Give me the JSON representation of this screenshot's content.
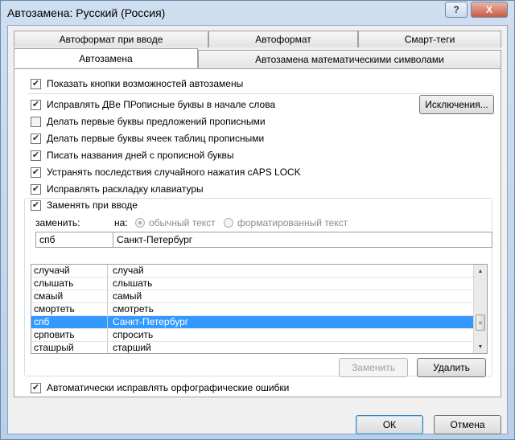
{
  "window": {
    "title": "Автозамена: Русский (Россия)",
    "help_label": "?",
    "close_label": "X"
  },
  "tabs": [
    {
      "label": "Автоформат при вводе"
    },
    {
      "label": "Автоформат"
    },
    {
      "label": "Смарт-теги"
    },
    {
      "label": "Автозамена"
    },
    {
      "label": "Автозамена математическими символами"
    }
  ],
  "options": {
    "show_buttons": {
      "label": "Показать кнопки возможностей автозамены",
      "checked": true
    },
    "two_caps": {
      "label": "Исправлять ДВе ПРописные буквы в начале слова",
      "checked": true
    },
    "sentence_caps": {
      "label": "Делать первые буквы предложений прописными",
      "checked": false
    },
    "table_caps": {
      "label": "Делать первые буквы ячеек таблиц прописными",
      "checked": true
    },
    "day_names": {
      "label": "Писать названия дней с прописной буквы",
      "checked": true
    },
    "caps_lock": {
      "label": "Устранять последствия случайного нажатия cAPS LOCK",
      "checked": true
    },
    "keyboard_layout": {
      "label": "Исправлять раскладку клавиатуры",
      "checked": true
    },
    "replace_typing": {
      "label": "Заменять при вводе",
      "checked": true
    },
    "auto_spelling": {
      "label": "Автоматически исправлять орфографические ошибки",
      "checked": true
    }
  },
  "exceptions_button": "Исключения...",
  "replace": {
    "replace_label": "заменить:",
    "with_label": "на:",
    "radio_plain": "обычный текст",
    "radio_formatted": "форматированный текст",
    "replace_value": "спб",
    "with_value": "Санкт-Петербург"
  },
  "list": {
    "rows": [
      {
        "from": "случачй",
        "to": "случай"
      },
      {
        "from": "слышать",
        "to": "слышать"
      },
      {
        "from": "смаый",
        "to": "самый"
      },
      {
        "from": "смортеть",
        "to": "смотреть"
      },
      {
        "from": "спб",
        "to": "Санкт-Петербург",
        "selected": true
      },
      {
        "from": "срповить",
        "to": "спросить"
      },
      {
        "from": "сташрый",
        "to": "старший"
      }
    ]
  },
  "buttons": {
    "replace": "Заменить",
    "delete": "Удалить",
    "ok": "ОК",
    "cancel": "Отмена"
  },
  "icons": {
    "check": "✔",
    "scroll_up": "▲",
    "scroll_down": "▼",
    "thumb_grip": "≡"
  }
}
